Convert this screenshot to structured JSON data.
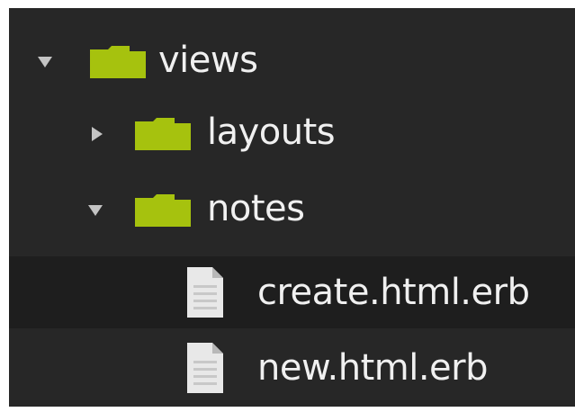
{
  "tree": {
    "views": {
      "label": "views",
      "expanded": true,
      "icon": "folder-icon"
    },
    "layouts": {
      "label": "layouts",
      "expanded": false,
      "icon": "folder-icon"
    },
    "notes": {
      "label": "notes",
      "expanded": true,
      "icon": "folder-icon"
    },
    "create": {
      "label": "create.html.erb",
      "selected": true,
      "icon": "file-icon"
    },
    "new": {
      "label": "new.html.erb",
      "selected": false,
      "icon": "file-icon"
    }
  },
  "colors": {
    "panel_bg": "#272727",
    "selected_bg": "#1e1e1e",
    "folder": "#a6c20e",
    "text": "#f0f0f0",
    "arrow": "#c4c4c4"
  }
}
